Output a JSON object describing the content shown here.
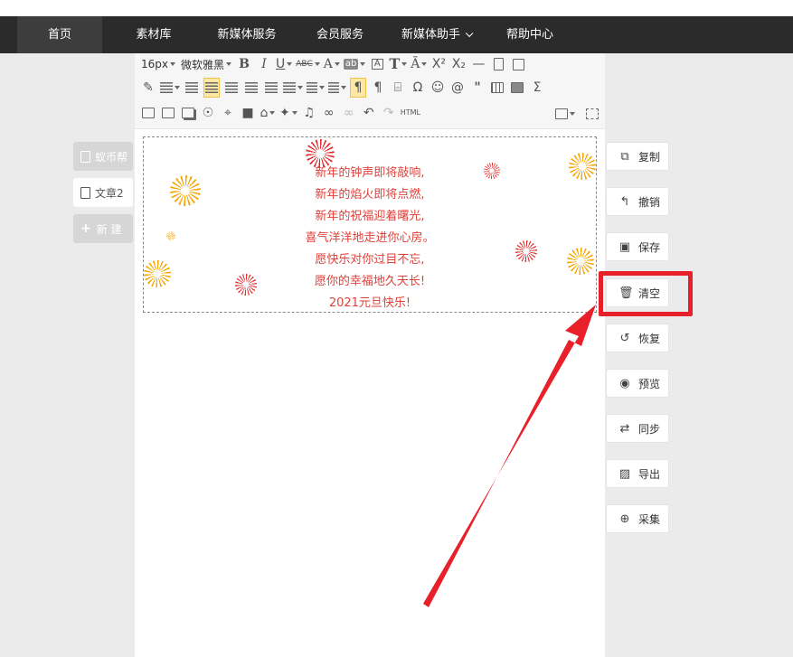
{
  "nav": {
    "items": [
      {
        "label": "首页"
      },
      {
        "label": "素材库"
      },
      {
        "label": "新媒体服务"
      },
      {
        "label": "会员服务"
      },
      {
        "label": "新媒体助手"
      },
      {
        "label": "帮助中心"
      }
    ]
  },
  "toolbar": {
    "font_size": "16px",
    "font_family": "微软雅黑",
    "html_label": "HTML",
    "omega_label": "Ω"
  },
  "sidebar": {
    "tabs": [
      {
        "label": "蚁币帮"
      },
      {
        "label": "文章2"
      },
      {
        "label": "新 建"
      }
    ]
  },
  "content": {
    "lines": [
      "新年的钟声即将敲响,",
      "新年的焰火即将点燃,",
      "新年的祝福迎着曙光,",
      "喜气洋洋地走进你心房。",
      "愿快乐对你过目不忘,",
      "愿你的幸福地久天长!",
      "2021元旦快乐!"
    ],
    "text_color": "#e0403a"
  },
  "actions": [
    {
      "label": "复制",
      "icon": "copy-icon"
    },
    {
      "label": "撤销",
      "icon": "undo-icon"
    },
    {
      "label": "保存",
      "icon": "save-icon"
    },
    {
      "label": "清空",
      "icon": "trash-icon"
    },
    {
      "label": "恢复",
      "icon": "restore-icon"
    },
    {
      "label": "预览",
      "icon": "eye-icon"
    },
    {
      "label": "同步",
      "icon": "sync-icon"
    },
    {
      "label": "导出",
      "icon": "export-image-icon"
    },
    {
      "label": "采集",
      "icon": "zoom-in-icon"
    }
  ],
  "colors": {
    "nav_bg": "#2b2b2b",
    "highlight": "#e8202a",
    "firework_orange": "#f7a500",
    "firework_red": "#e52b2b"
  }
}
